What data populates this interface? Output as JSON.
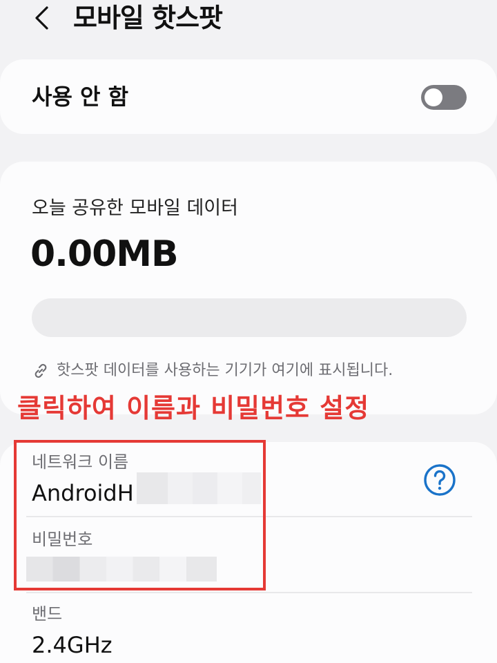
{
  "header": {
    "title": "모바일 핫스팟",
    "back_icon": "chevron-left-icon"
  },
  "hotspot_toggle": {
    "label": "사용 안 함",
    "state": "off"
  },
  "data_usage": {
    "label": "오늘 공유한 모바일 데이터",
    "value": "0.00MB",
    "progress_fraction": 0,
    "hint": "핫스팟 데이터를 사용하는 기기가 여기에 표시됩니다.",
    "hint_icon": "link-icon"
  },
  "annotation": {
    "text": "클릭하여 이름과 비밀번호 설정",
    "color": "#e53935"
  },
  "settings": {
    "network_name": {
      "label": "네트워크 이름",
      "value": "AndroidH"
    },
    "password": {
      "label": "비밀번호",
      "value": ""
    },
    "band": {
      "label": "밴드",
      "value": "2.4GHz"
    },
    "help_icon": "question-circle-icon"
  },
  "colors": {
    "accent": "#1a73c9",
    "annotation_red": "#e53935",
    "background": "#f2f2f4",
    "card": "#fcfcfd"
  }
}
